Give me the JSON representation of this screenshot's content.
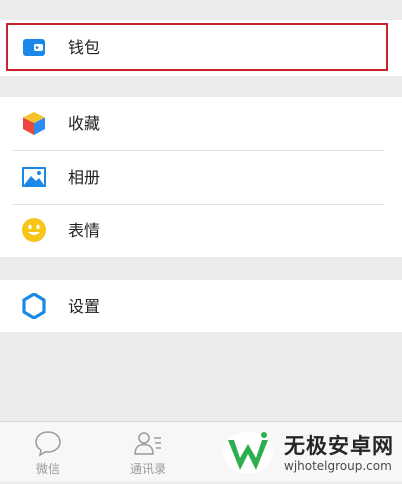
{
  "menu": {
    "wallet": {
      "label": "钱包",
      "icon": "wallet-icon",
      "color": "#1a88e8"
    },
    "favorites": {
      "label": "收藏",
      "icon": "cube-icon"
    },
    "album": {
      "label": "相册",
      "icon": "image-icon",
      "color": "#1a88e8"
    },
    "stickers": {
      "label": "表情",
      "icon": "smiley-icon",
      "color": "#f5c518"
    },
    "settings": {
      "label": "设置",
      "icon": "gear-icon",
      "color": "#1a88e8"
    }
  },
  "tabbar": {
    "chats": {
      "label": "微信",
      "icon": "chat-bubble-icon"
    },
    "contacts": {
      "label": "通讯录",
      "icon": "contacts-icon"
    }
  },
  "watermark": {
    "brand": "无极安卓网",
    "domain": "wjhotelgroup.com",
    "accent": "#2eae4e"
  },
  "highlight_color": "#c9232e"
}
